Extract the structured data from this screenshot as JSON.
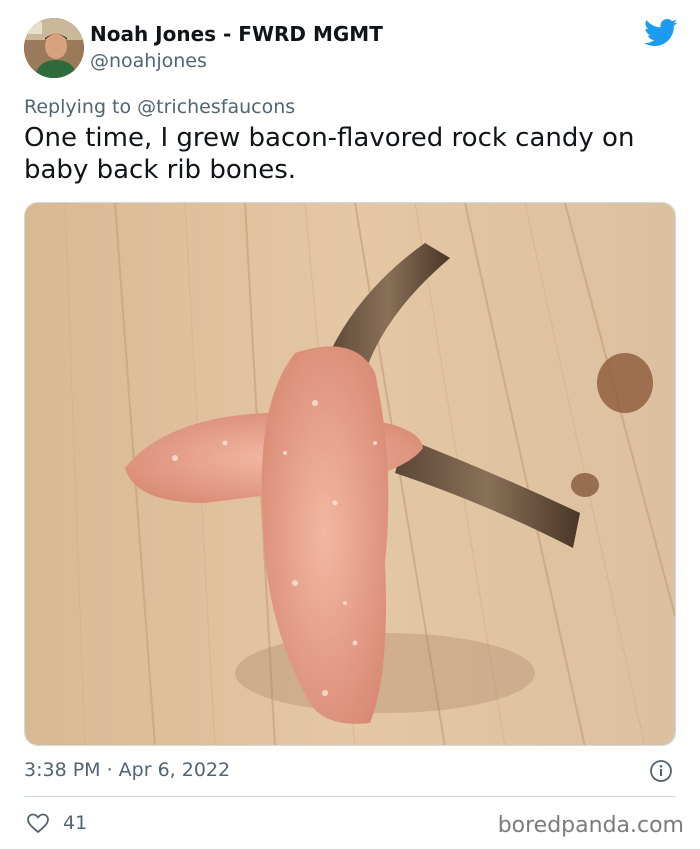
{
  "author": {
    "display_name": "Noah Jones - FWRD MGMT",
    "handle": "@noahjones"
  },
  "reply": {
    "prefix": "Replying to ",
    "mention": "@trichesfaucons"
  },
  "tweet": {
    "text": "One time, I grew bacon-flavored rock candy on baby back rib bones.",
    "timestamp": "3:38 PM · Apr 6, 2022",
    "likes": "41"
  },
  "watermark": "boredpanda.com",
  "icons": {
    "brand": "twitter-bird-icon",
    "info": "info-icon",
    "like": "heart-icon"
  },
  "colors": {
    "twitter_blue": "#1d9bf0",
    "secondary_text": "#536471",
    "primary_text": "#0f1419"
  }
}
